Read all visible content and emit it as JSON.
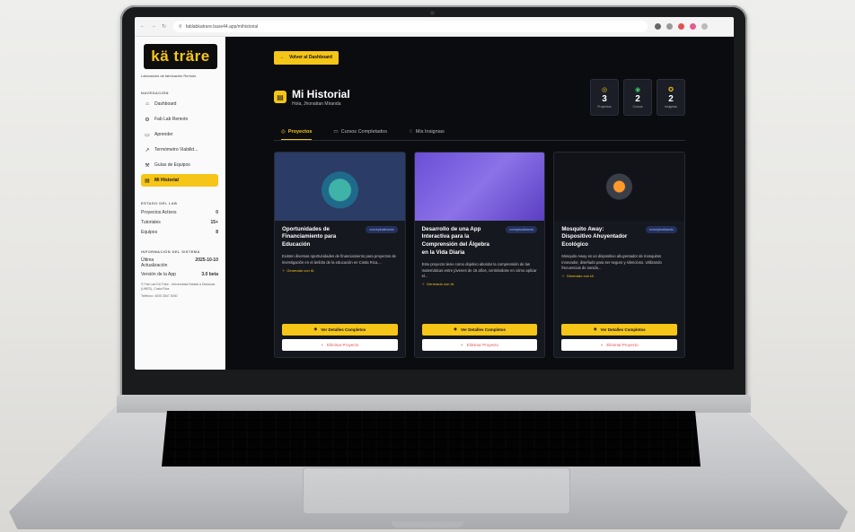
{
  "browser": {
    "url": "fablabkatrare.base44.app/mihistorial"
  },
  "sidebar": {
    "logo": "kä träre",
    "tagline": "Laboratorio de fabricación Remoto",
    "nav_title": "NAVEGACIÓN",
    "items": [
      {
        "label": "Dashboard",
        "icon": "home-icon"
      },
      {
        "label": "Fab Lab Remoto",
        "icon": "gear-icon"
      },
      {
        "label": "Aprender",
        "icon": "book-icon"
      },
      {
        "label": "Termómetro Viabilid...",
        "icon": "trend-icon"
      },
      {
        "label": "Guías de Equipos",
        "icon": "wrench-icon"
      },
      {
        "label": "Mi Historial",
        "icon": "folder-icon",
        "active": true
      }
    ],
    "lab_title": "ESTADO DEL LAB",
    "lab_stats": [
      {
        "label": "Proyectos Activos",
        "value": "0"
      },
      {
        "label": "Tutoriales",
        "value": "15+"
      },
      {
        "label": "Equipos",
        "value": "8"
      }
    ],
    "sys_title": "INFORMACIÓN DEL SISTEMA",
    "sys_update_label": "Última Actualización",
    "sys_update_value": "2025-10-10",
    "sys_version_label": "Versión de la App",
    "sys_version_value": "3.0 beta",
    "footer": "© Fab Lab Kä Träre - Universidad Estatal a Distancia (UNED), Costa Rica",
    "footer_phone": "Teléfono: 4000 2847 0000"
  },
  "main": {
    "back_label": "Volver al Dashboard",
    "title": "Mi Historial",
    "subtitle": "Hola, Jhonattan Miranda",
    "counters": [
      {
        "value": "3",
        "label": "Proyectos",
        "icon": "target-icon"
      },
      {
        "value": "2",
        "label": "Cursos",
        "icon": "check-circle-icon"
      },
      {
        "value": "2",
        "label": "Insignias",
        "icon": "award-icon"
      }
    ],
    "tabs": [
      {
        "label": "Proyectos",
        "active": true
      },
      {
        "label": "Cursos Completados",
        "active": false
      },
      {
        "label": "Mis Insignias",
        "active": false
      }
    ],
    "cards": [
      {
        "title": "Oportunidades de Financiamiento para Educación",
        "badge": "conceptualizando",
        "desc": "Existen diversas oportunidades de financiamiento para proyectos de investigación en el ámbito de la educación en Costa Rica,...",
        "generated": "Generado con IA",
        "details": "Ver Detalles Completos",
        "delete": "Eliminar Proyecto"
      },
      {
        "title": "Desarrollo de una App Interactiva para la Comprensión del Álgebra en la Vida Diaria",
        "badge": "conceptualizando",
        "desc": "Este proyecto tiene como objetivo abordar la comprensión de las matemáticas entre jóvenes de 15 años, centrándose en cómo aplicar el...",
        "generated": "Generado con IA",
        "details": "Ver Detalles Completos",
        "delete": "Eliminar Proyecto"
      },
      {
        "title": "Mosquito Away: Dispositivo Ahuyentador Ecológico",
        "badge": "conceptualizando",
        "desc": "Mosquito Away es un dispositivo ahuyentador de mosquitos innovador, diseñado para ser seguro y silencioso. Utilizando frecuencias de sonido...",
        "generated": "Generado con IA",
        "details": "Ver Detalles Completos",
        "delete": "Eliminar Proyecto"
      }
    ]
  },
  "colors": {
    "accent": "#f5c518",
    "dark_bg": "#0b0c10",
    "card_bg": "#16181f",
    "danger": "#e05252"
  }
}
